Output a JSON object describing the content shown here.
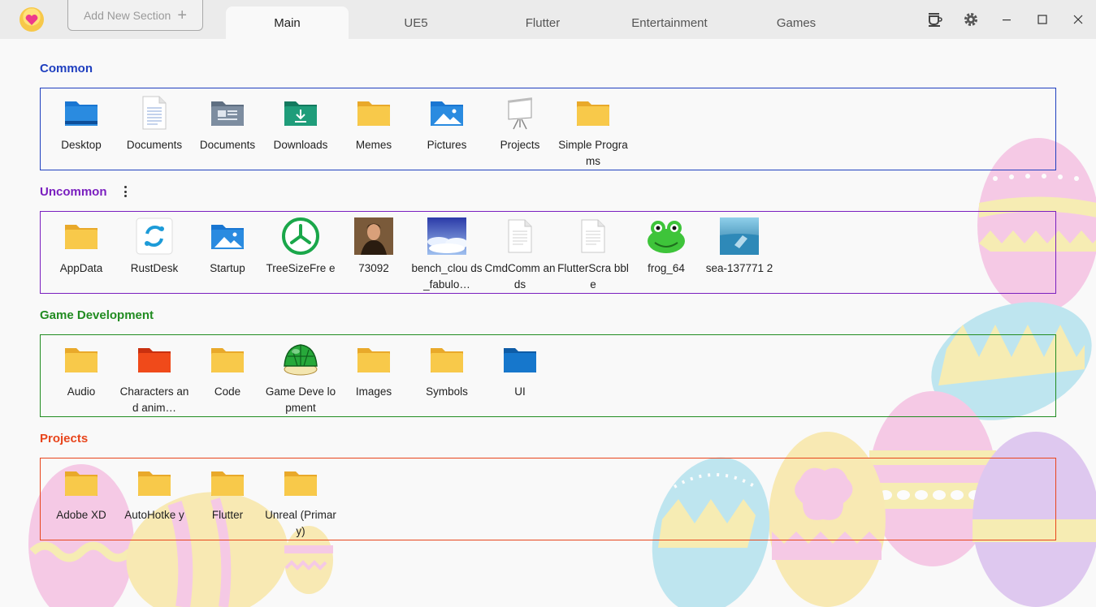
{
  "toolbar": {
    "add_section_label": "Add New Section",
    "add_section_plus": "+"
  },
  "tabs": [
    {
      "label": "Main",
      "active": true
    },
    {
      "label": "UE5",
      "active": false
    },
    {
      "label": "Flutter",
      "active": false
    },
    {
      "label": "Entertainment",
      "active": false
    },
    {
      "label": "Games",
      "active": false
    }
  ],
  "colors": {
    "common": "#1f3fbf",
    "uncommon": "#7a1fbf",
    "game_dev": "#218c21",
    "projects": "#e8451c",
    "folder": "#f8c94a"
  },
  "sections": [
    {
      "title": "Common",
      "color": "#1f3fbf",
      "items": [
        {
          "label": "Desktop",
          "icon": "desktop-folder-icon"
        },
        {
          "label": "Documents",
          "icon": "document-icon"
        },
        {
          "label": "Documents",
          "icon": "documents-folder-icon"
        },
        {
          "label": "Downloads",
          "icon": "downloads-folder-icon"
        },
        {
          "label": "Memes",
          "icon": "folder-icon"
        },
        {
          "label": "Pictures",
          "icon": "pictures-folder-icon"
        },
        {
          "label": "Projects",
          "icon": "presentation-icon"
        },
        {
          "label": "Simple Programs",
          "icon": "folder-icon"
        }
      ]
    },
    {
      "title": "Uncommon",
      "color": "#7a1fbf",
      "items": [
        {
          "label": "AppData",
          "icon": "folder-icon"
        },
        {
          "label": "RustDesk",
          "icon": "rustdesk-icon"
        },
        {
          "label": "Startup",
          "icon": "pictures-folder-icon"
        },
        {
          "label": "TreeSizeFre e",
          "icon": "treesize-icon"
        },
        {
          "label": "73092",
          "icon": "portrait-image-icon"
        },
        {
          "label": "bench_clou ds_fabulo…",
          "icon": "clouds-image-icon"
        },
        {
          "label": "CmdComm ands",
          "icon": "text-file-icon"
        },
        {
          "label": "FlutterScra bble",
          "icon": "text-file-icon"
        },
        {
          "label": "frog_64",
          "icon": "frog-icon"
        },
        {
          "label": "sea-137771 2",
          "icon": "sea-image-icon"
        }
      ]
    },
    {
      "title": "Game Development",
      "color": "#218c21",
      "items": [
        {
          "label": "Audio",
          "icon": "folder-icon"
        },
        {
          "label": "Characters and anim…",
          "icon": "red-folder-icon"
        },
        {
          "label": "Code",
          "icon": "folder-icon"
        },
        {
          "label": "Game Deve lopment",
          "icon": "turtle-shell-icon"
        },
        {
          "label": "Images",
          "icon": "folder-icon"
        },
        {
          "label": "Symbols",
          "icon": "folder-icon"
        },
        {
          "label": "UI",
          "icon": "blue-folder-icon"
        }
      ]
    },
    {
      "title": "Projects",
      "color": "#e8451c",
      "items": [
        {
          "label": "Adobe XD",
          "icon": "folder-icon"
        },
        {
          "label": "AutoHotke y",
          "icon": "folder-icon"
        },
        {
          "label": "Flutter",
          "icon": "folder-icon"
        },
        {
          "label": "Unreal (Primary)",
          "icon": "folder-icon"
        }
      ]
    }
  ]
}
